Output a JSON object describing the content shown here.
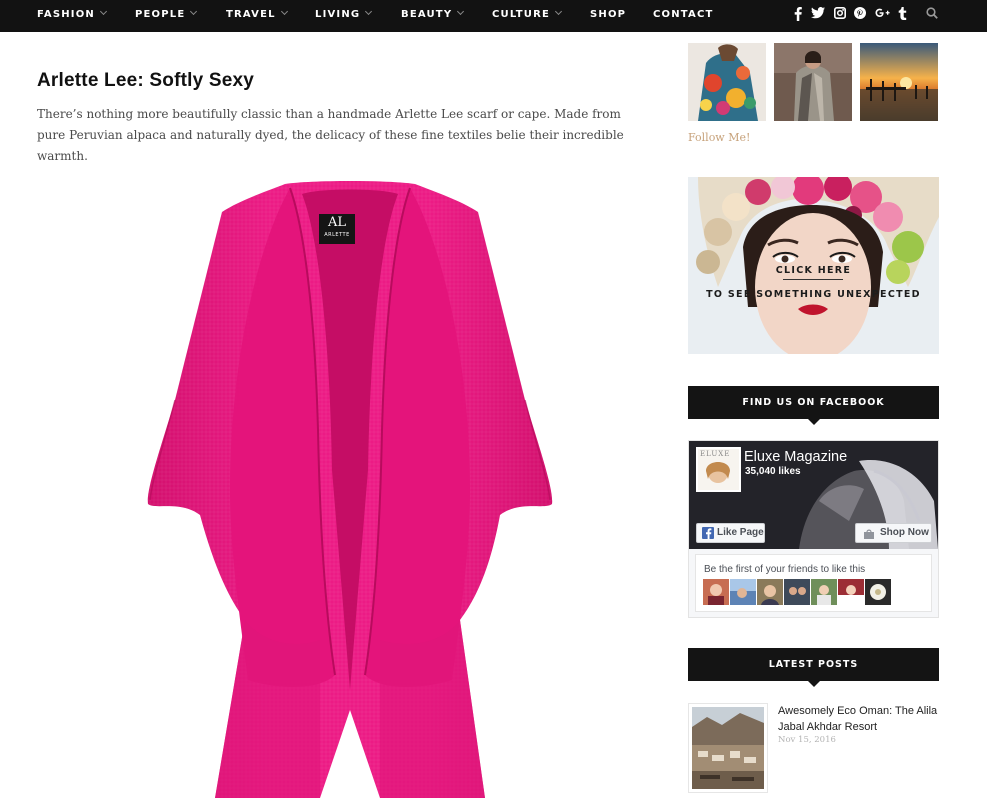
{
  "nav": {
    "items": [
      {
        "label": "FASHION",
        "dropdown": true
      },
      {
        "label": "PEOPLE",
        "dropdown": true
      },
      {
        "label": "TRAVEL",
        "dropdown": true
      },
      {
        "label": "LIVING",
        "dropdown": true
      },
      {
        "label": "BEAUTY",
        "dropdown": true
      },
      {
        "label": "CULTURE",
        "dropdown": true
      },
      {
        "label": "SHOP",
        "dropdown": false
      },
      {
        "label": "CONTACT",
        "dropdown": false
      }
    ],
    "social_icons": [
      "facebook-icon",
      "twitter-icon",
      "instagram-icon",
      "pinterest-icon",
      "google-plus-icon",
      "tumblr-icon",
      "search-icon"
    ]
  },
  "article": {
    "title": "Arlette Lee: Softly Sexy",
    "intro": "There’s nothing more beautifully classic than a handmade Arlette Lee scarf or cape. Made from pure Peruvian alpaca and naturally dyed, the delicacy of these fine textiles belie their incredible warmth.",
    "label_logo": "AL",
    "label_brand": "ARLETTE",
    "accent_color": "#e8177f"
  },
  "sidebar": {
    "instagram_thumbs": [
      "instagram-thumb-floral-jacket",
      "instagram-thumb-fur-coat",
      "instagram-thumb-sunset-pier"
    ],
    "follow_label": "Follow Me!",
    "ad": {
      "line1": "CLICK HERE",
      "line2": "TO SEE SOMETHING UNEXPECTED"
    },
    "facebook": {
      "heading": "FIND US ON FACEBOOK",
      "page_name": "Eluxe Magazine",
      "likes": "35,040 likes",
      "like_button": "Like Page",
      "shop_button": "Shop Now",
      "friends_text": "Be the first of your friends to like this",
      "logo_text": "ELUXE",
      "friend_count": 8
    },
    "latest": {
      "heading": "LATEST POSTS",
      "post_title": "Awesomely Eco Oman: The Alila Jabal Akhdar Resort",
      "post_date": "Nov 15, 2016"
    }
  }
}
